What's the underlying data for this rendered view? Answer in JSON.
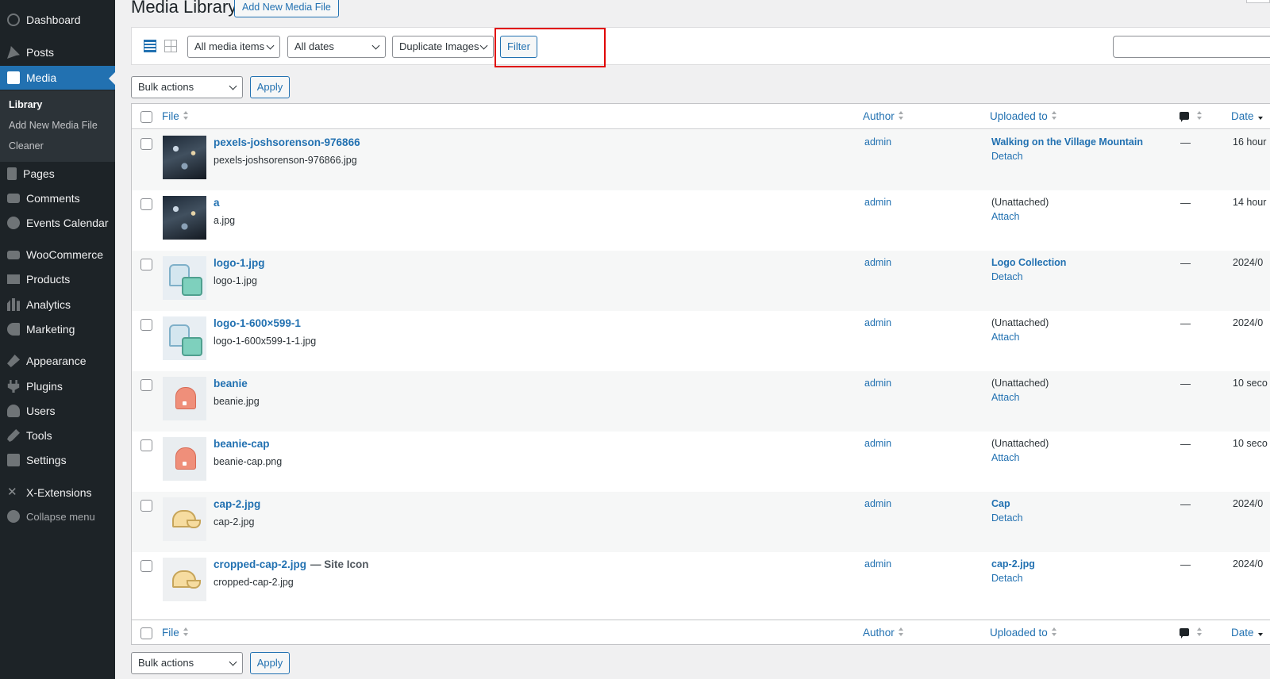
{
  "sidebar": {
    "dashboard": "Dashboard",
    "posts": "Posts",
    "media": "Media",
    "submenu": {
      "library": "Library",
      "add_new": "Add New Media File",
      "cleaner": "Cleaner"
    },
    "pages": "Pages",
    "comments": "Comments",
    "events_calendar": "Events Calendar",
    "woocommerce": "WooCommerce",
    "products": "Products",
    "analytics": "Analytics",
    "marketing": "Marketing",
    "appearance": "Appearance",
    "plugins": "Plugins",
    "users": "Users",
    "tools": "Tools",
    "settings": "Settings",
    "x_extensions": "X-Extensions",
    "collapse": "Collapse menu"
  },
  "header": {
    "title": "Media Library",
    "add_new": "Add New Media File"
  },
  "filters": {
    "media_type": "All media items",
    "dates": "All dates",
    "duplicate": "Duplicate Images",
    "filter_button": "Filter",
    "search_value": ""
  },
  "bulk": {
    "top_select": "Bulk actions",
    "top_apply": "Apply",
    "bottom_select": "Bulk actions",
    "bottom_apply": "Apply"
  },
  "columns": {
    "file": "File",
    "author": "Author",
    "uploaded_to": "Uploaded to",
    "date": "Date"
  },
  "rows": [
    {
      "title": "pexels-joshsorenson-976866",
      "suffix": "",
      "filename": "pexels-joshsorenson-976866.jpg",
      "author": "admin",
      "uploaded_to": "Walking on the Village Mountain",
      "action": "Detach",
      "comments": "—",
      "date": "16 hour"
    },
    {
      "title": "a",
      "suffix": "",
      "filename": "a.jpg",
      "author": "admin",
      "uploaded_to": "(Unattached)",
      "action": "Attach",
      "comments": "—",
      "date": "14 hour"
    },
    {
      "title": "logo-1.jpg",
      "suffix": "",
      "filename": "logo-1.jpg",
      "author": "admin",
      "uploaded_to": "Logo Collection",
      "action": "Detach",
      "comments": "—",
      "date": "2024/0"
    },
    {
      "title": "logo-1-600×599-1",
      "suffix": "",
      "filename": "logo-1-600x599-1-1.jpg",
      "author": "admin",
      "uploaded_to": "(Unattached)",
      "action": "Attach",
      "comments": "—",
      "date": "2024/0"
    },
    {
      "title": "beanie",
      "suffix": "",
      "filename": "beanie.jpg",
      "author": "admin",
      "uploaded_to": "(Unattached)",
      "action": "Attach",
      "comments": "—",
      "date": "10 seco"
    },
    {
      "title": "beanie-cap",
      "suffix": "",
      "filename": "beanie-cap.png",
      "author": "admin",
      "uploaded_to": "(Unattached)",
      "action": "Attach",
      "comments": "—",
      "date": "10 seco"
    },
    {
      "title": "cap-2.jpg",
      "suffix": "",
      "filename": "cap-2.jpg",
      "author": "admin",
      "uploaded_to": "Cap",
      "action": "Detach",
      "comments": "—",
      "date": "2024/0"
    },
    {
      "title": "cropped-cap-2.jpg",
      "suffix": "— Site Icon",
      "filename": "cropped-cap-2.jpg",
      "author": "admin",
      "uploaded_to": "cap-2.jpg",
      "action": "Detach",
      "comments": "—",
      "date": "2024/0"
    }
  ],
  "colors": {
    "sidebar_bg": "#1d2327",
    "accent": "#2271b1",
    "highlight": "#e00000"
  }
}
